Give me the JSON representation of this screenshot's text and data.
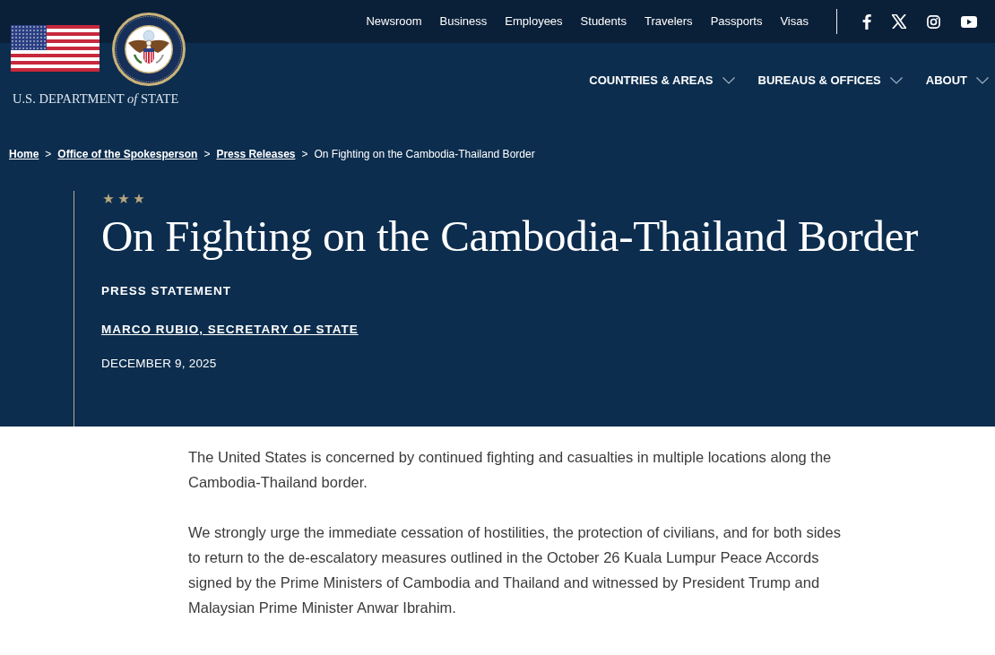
{
  "header": {
    "agency_name": "U.S. DEPARTMENT *of* STATE",
    "utility_links": [
      "Newsroom",
      "Business",
      "Employees",
      "Students",
      "Travelers",
      "Passports",
      "Visas"
    ],
    "main_nav": [
      "COUNTRIES & AREAS",
      "BUREAUS & OFFICES",
      "ABOUT"
    ]
  },
  "breadcrumb": [
    {
      "label": "Home",
      "kind": "link"
    },
    {
      "label": ">",
      "kind": "separator"
    },
    {
      "label": "Office of the Spokesperson",
      "kind": "link"
    },
    {
      "label": ">",
      "kind": "separator"
    },
    {
      "label": "Press Releases",
      "kind": "link"
    },
    {
      "label": ">",
      "kind": "separator"
    },
    {
      "label": "On Fighting on the Cambodia-Thailand Border",
      "kind": "current"
    }
  ],
  "article": {
    "title": "On Fighting on the Cambodia-Thailand Border",
    "type_label": "PRESS STATEMENT",
    "author": "MARCO RUBIO, SECRETARY OF STATE",
    "date": "DECEMBER 9, 2025",
    "paragraphs": [
      "The United States is concerned by continued fighting and casualties in multiple locations along the Cambodia-Thailand border.",
      "We strongly urge the immediate cessation of hostilities, the protection of civilians, and for both sides to return to the de-escalatory measures outlined in the October 26 Kuala Lumpur Peace Accords signed by the Prime Ministers of Cambodia and Thailand and witnessed by President Trump and Malaysian Prime Minister Anwar Ibrahim."
    ]
  }
}
